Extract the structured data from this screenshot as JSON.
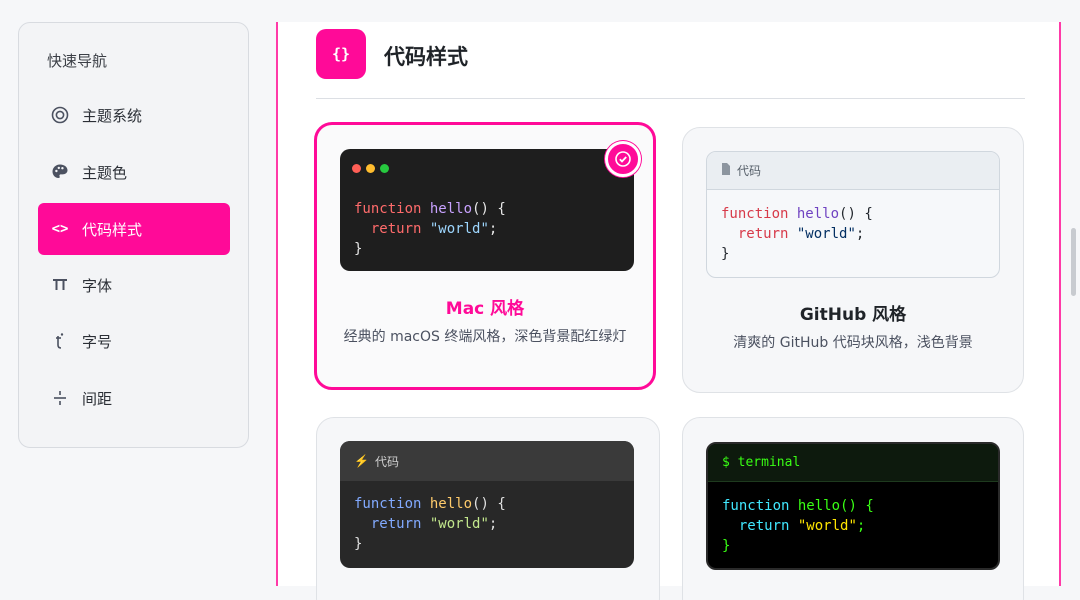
{
  "sidebar": {
    "title": "快速导航",
    "items": [
      {
        "label": "主题系统",
        "icon": "target-icon"
      },
      {
        "label": "主题色",
        "icon": "palette-icon"
      },
      {
        "label": "代码样式",
        "icon": "code-icon",
        "active": true
      },
      {
        "label": "字体",
        "icon": "font-icon"
      },
      {
        "label": "字号",
        "icon": "font-size-icon"
      },
      {
        "label": "间距",
        "icon": "spacing-icon"
      }
    ]
  },
  "section": {
    "icon_text": "{}",
    "title": "代码样式"
  },
  "code_sample": {
    "keyword": "function",
    "fn_name": "hello",
    "call": "() {",
    "return_kw": "return",
    "string": "\"world\"",
    "semicolon": ";",
    "close": "}"
  },
  "cards": [
    {
      "name": "Mac 风格",
      "desc": "经典的 macOS 终端风格，深色背景配红绿灯",
      "selected": true
    },
    {
      "name": "GitHub 风格",
      "desc": "清爽的 GitHub 代码块风格，浅色背景",
      "header_label": "代码"
    },
    {
      "header_label": "代码"
    },
    {
      "header_label": "$ terminal"
    }
  ],
  "colors": {
    "accent": "#ff0a98",
    "mac_bg": "#1e1e1e",
    "github_bg": "#f6f8fa",
    "terminal_bg": "#000000"
  }
}
